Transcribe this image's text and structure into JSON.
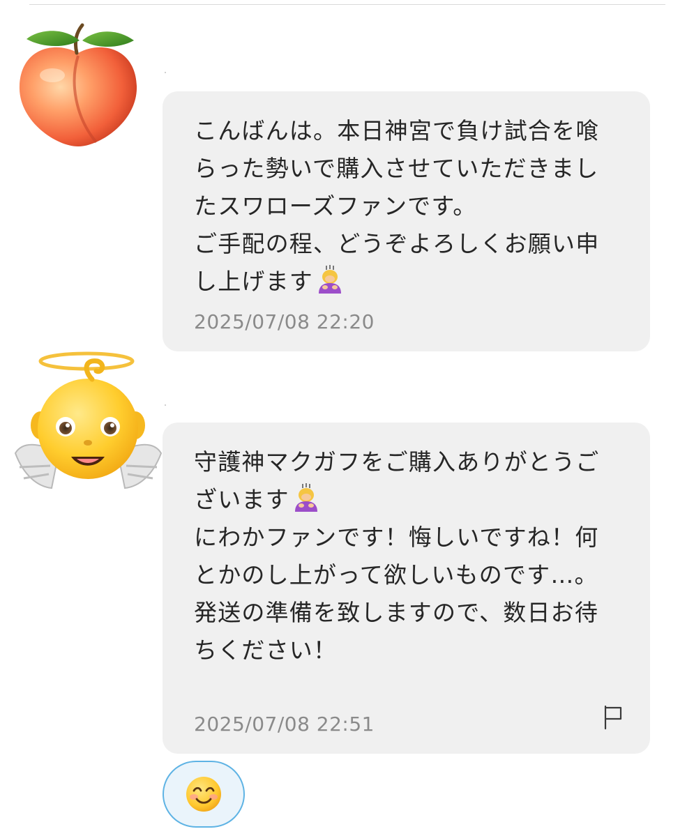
{
  "thread": {
    "messages": [
      {
        "avatar": "peach-emoji-icon",
        "text": "こんばんは。本日神宮で負け試合を喰らった勢いで購入させていただきましたスワローズファンです。\nご手配の程、どうぞよろしくお願い申し上げます",
        "trailing_emoji": "woman-bowing-icon",
        "timestamp": "2025/07/08 22:20"
      },
      {
        "avatar": "baby-angel-emoji-icon",
        "text_part1": "守護神マクガフをご購入ありがとうございます",
        "inline_emoji": "woman-bowing-icon",
        "text_part2": "\nにわかファンです！悔しいですね！何とかのし上がって欲しいものです…。\n発送の準備を致しますので、数日お待ちください！",
        "timestamp": "2025/07/08 22:51",
        "report_icon": "flag-icon"
      }
    ],
    "reaction": {
      "icon": "smiling-face-with-smiling-eyes-icon"
    }
  },
  "colors": {
    "bubble_bg": "#f0f0f0",
    "timestamp": "#8a8a8a",
    "reaction_border": "#5eb3e4",
    "reaction_bg": "#eaf4fb"
  }
}
